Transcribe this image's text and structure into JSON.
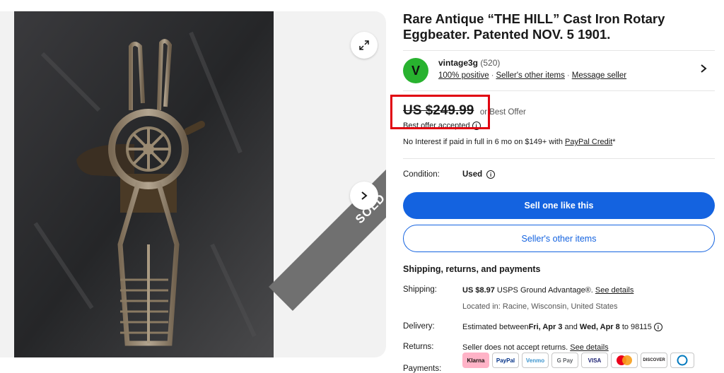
{
  "listing": {
    "title": "Rare Antique “THE HILL” Cast Iron Rotary Eggbeater. Patented NOV. 5 1901.",
    "sold_label": "SOLD",
    "image_alt": "Cast iron rotary eggbeater photo"
  },
  "seller": {
    "initial": "V",
    "name": "vintage3g",
    "feedback_count": "(520)",
    "positive": "100% positive",
    "other_items": "Seller's other items",
    "message": "Message seller"
  },
  "price": {
    "amount": "US $249.99",
    "or": "or Best Offer",
    "offer_accepted": "Best offer accepted"
  },
  "financing": {
    "text": "No Interest if paid in full in 6 mo on $149+ with ",
    "link": "PayPal Credit",
    "suffix": "*"
  },
  "condition": {
    "label": "Condition:",
    "value": "Used"
  },
  "buttons": {
    "sell_one": "Sell one like this",
    "seller_items": "Seller's other items"
  },
  "shipping": {
    "heading": "Shipping, returns, and payments",
    "shipping_label": "Shipping:",
    "shipping_cost": "US $8.97",
    "shipping_service": " USPS Ground Advantage®. ",
    "shipping_link": "See details",
    "location": "Located in: Racine, Wisconsin, United States",
    "delivery_label": "Delivery:",
    "delivery_prefix": "Estimated between ",
    "delivery_start": "Fri, Apr 3",
    "delivery_and": " and ",
    "delivery_end": "Wed, Apr 8",
    "delivery_suffix": " to 98115",
    "returns_label": "Returns:",
    "returns_text": "Seller does not accept returns. ",
    "returns_link": "See details",
    "payments_label": "Payments:"
  },
  "payment_methods": [
    "Klarna",
    "PayPal",
    "Venmo",
    "G Pay",
    "VISA",
    "Mastercard",
    "DISCOVER",
    "Diners"
  ],
  "icons": [
    "expand-icon",
    "chevron-right-icon",
    "info-icon"
  ],
  "colors": {
    "primary_blue": "#1463e0",
    "avatar_green": "#28b22f",
    "highlight_red": "#e0000f",
    "sold_gray": "#707070"
  }
}
